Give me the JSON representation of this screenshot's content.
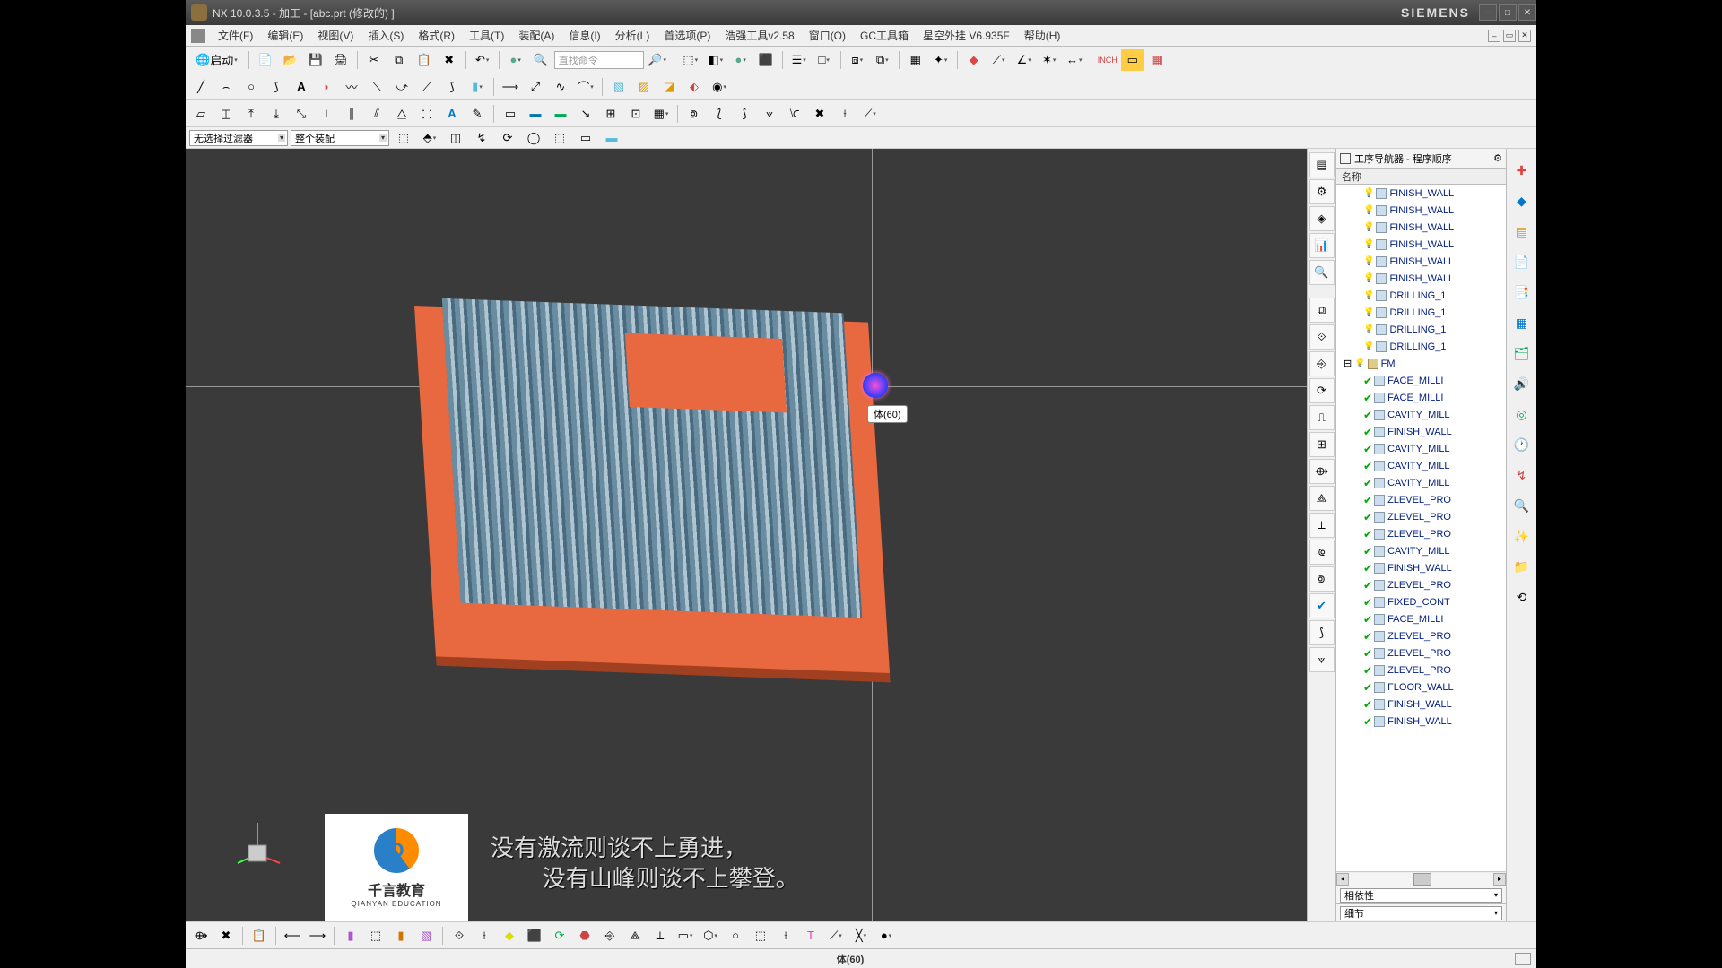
{
  "title": "NX 10.0.3.5 - 加工 - [abc.prt  (修改的)  ]",
  "brand": "SIEMENS",
  "menus": [
    "文件(F)",
    "编辑(E)",
    "视图(V)",
    "插入(S)",
    "格式(R)",
    "工具(T)",
    "装配(A)",
    "信息(I)",
    "分析(L)",
    "首选项(P)",
    "浩强工具v2.58",
    "窗口(O)",
    "GC工具箱",
    "星空外挂 V6.935F",
    "帮助(H)"
  ],
  "start_label": "启动",
  "search_placeholder": "直找命令",
  "filter1": "无选择过滤器",
  "filter2": "整个装配",
  "viewport_tip": "体(60)",
  "logo_line1": "千言教育",
  "logo_line2": "QIANYAN EDUCATION",
  "subtitle_text": "没有激流则谈不上勇进，\n        没有山峰则谈不上攀登。",
  "nav_title": "工序导航器 - 程序顺序",
  "nav_col": "名称",
  "tree_items": [
    {
      "status": "bulb",
      "label": "FINISH_WALL"
    },
    {
      "status": "bulb",
      "label": "FINISH_WALL"
    },
    {
      "status": "bulb",
      "label": "FINISH_WALL"
    },
    {
      "status": "bulb",
      "label": "FINISH_WALL"
    },
    {
      "status": "bulb",
      "label": "FINISH_WALL"
    },
    {
      "status": "bulb",
      "label": "FINISH_WALL"
    },
    {
      "status": "bulb",
      "label": "DRILLING_1"
    },
    {
      "status": "bulb",
      "label": "DRILLING_1"
    },
    {
      "status": "bulb",
      "label": "DRILLING_1"
    },
    {
      "status": "bulb",
      "label": "DRILLING_1"
    },
    {
      "status": "group",
      "label": "FM"
    },
    {
      "status": "tick",
      "label": "FACE_MILLI"
    },
    {
      "status": "tick",
      "label": "FACE_MILLI"
    },
    {
      "status": "tick",
      "label": "CAVITY_MILL"
    },
    {
      "status": "tick",
      "label": "FINISH_WALL"
    },
    {
      "status": "tick",
      "label": "CAVITY_MILL"
    },
    {
      "status": "tick",
      "label": "CAVITY_MILL"
    },
    {
      "status": "tick",
      "label": "CAVITY_MILL"
    },
    {
      "status": "tick",
      "label": "ZLEVEL_PRO"
    },
    {
      "status": "tick",
      "label": "ZLEVEL_PRO"
    },
    {
      "status": "tick",
      "label": "ZLEVEL_PRO"
    },
    {
      "status": "tick",
      "label": "CAVITY_MILL"
    },
    {
      "status": "tick",
      "label": "FINISH_WALL"
    },
    {
      "status": "tick",
      "label": "ZLEVEL_PRO"
    },
    {
      "status": "tick",
      "label": "FIXED_CONT"
    },
    {
      "status": "tick",
      "label": "FACE_MILLI"
    },
    {
      "status": "tick",
      "label": "ZLEVEL_PRO"
    },
    {
      "status": "tick",
      "label": "ZLEVEL_PRO"
    },
    {
      "status": "tick",
      "label": "ZLEVEL_PRO"
    },
    {
      "status": "tick",
      "label": "FLOOR_WALL"
    },
    {
      "status": "tick",
      "label": "FINISH_WALL"
    },
    {
      "status": "tick",
      "label": "FINISH_WALL"
    }
  ],
  "panel_combo1": "相依性",
  "panel_combo2": "细节",
  "status_selection": "体(60)"
}
